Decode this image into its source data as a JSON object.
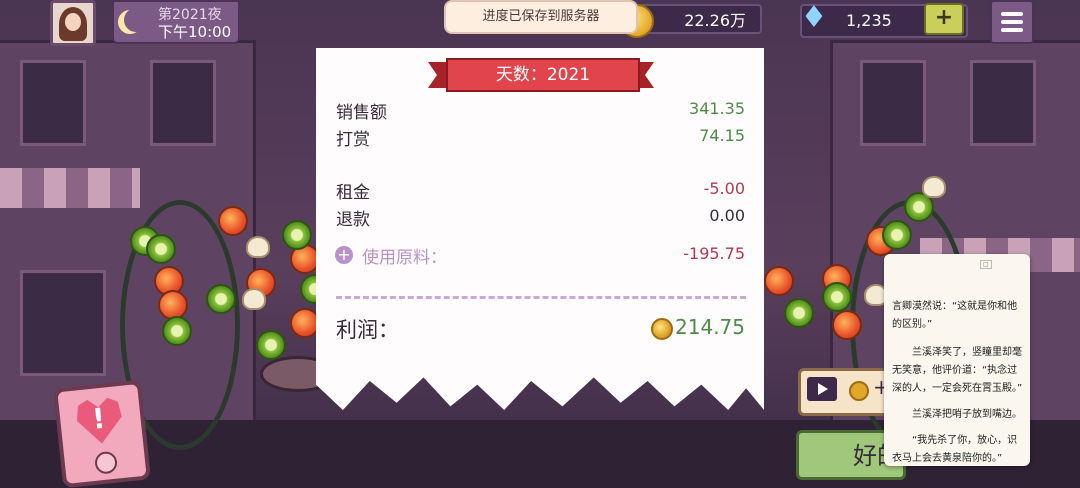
{
  "top_bar": {
    "night_label": "第2021夜",
    "time_label": "下午10:00",
    "save_toast": "进度已保存到服务器",
    "coins": "22.26万",
    "gems": "1,235",
    "add_label": "+"
  },
  "receipt": {
    "day_title": "天数：2021",
    "rows": [
      {
        "label": "销售额",
        "value": "341.35"
      },
      {
        "label": "打赏",
        "value": "74.15"
      },
      {
        "label": "租金",
        "value": "-5.00"
      },
      {
        "label": "退款",
        "value": "0.00"
      },
      {
        "label": "使用原料：",
        "value": "-195.75"
      }
    ],
    "profit_label": "利润：",
    "profit_value": "214.75"
  },
  "buttons": {
    "ad_plus": "+",
    "ok_label": "好的"
  },
  "reader": {
    "lines": [
      "言卿漠然说：“这就是你和他的区别。”",
      "兰溪泽笑了，竖瞳里却毫无笑意，他评价道：“执念过深的人，一定会死在霄玉殿。”",
      "兰溪泽把哨子放到嘴边。",
      "“我先杀了你，放心，识衣马上会去黄泉陪你的。”"
    ]
  },
  "colors": {
    "positive": "#4f8a4a",
    "negative": "#b23a50",
    "ribbon": "#e2444b",
    "ok_button": "#9fc87a"
  },
  "icons": {
    "night": "moon-icon",
    "coin": "coin-icon",
    "gem": "diamond-icon",
    "menu": "hamburger-icon",
    "ad": "video-play-icon",
    "phone": "heart-phone-icon"
  }
}
